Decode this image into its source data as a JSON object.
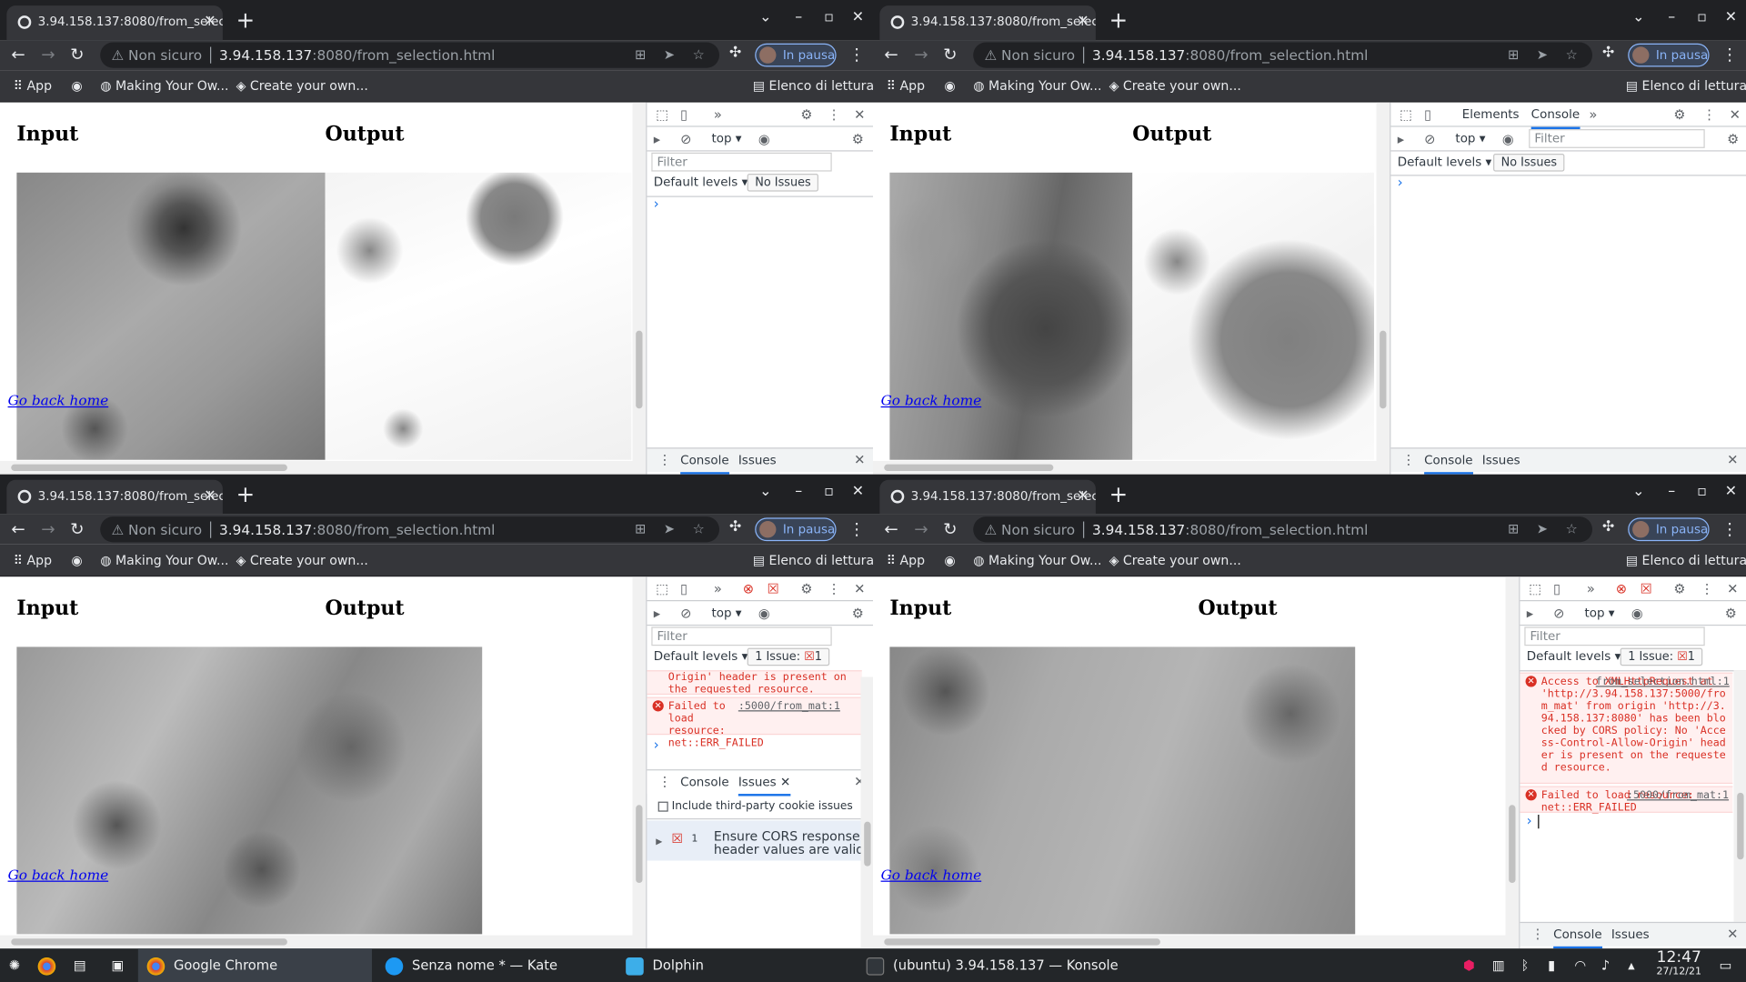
{
  "browser": {
    "tab_title": "3.94.158.137:8080/from_selec",
    "new_tab": "+",
    "tab_close": "✕",
    "url_security": "Non sicuro",
    "url_host": "3.94.158.137",
    "url_rest": ":8080/from_selection.html",
    "profile_status": "In pausa",
    "bookmarks": [
      "App",
      "Making Your Ow...",
      "Create your own...",
      "Elenco di lettura"
    ]
  },
  "page": {
    "input_heading": "Input",
    "output_heading": "Output",
    "go_back_link": "Go back home"
  },
  "devtools": {
    "context": "top",
    "filter_placeholder": "Filter",
    "default_levels": "Default levels",
    "no_issues": "No Issues",
    "one_issue": "1 Issue:",
    "issue_count": "1",
    "tab_elements": "Elements",
    "tab_console": "Console",
    "tab_issues": "Issues",
    "prompt": "›",
    "cors_tail": "Origin' header is present on the requested resource.",
    "failed_prefix": "Failed to load resource: net::ERR_FAILED",
    "failed_source": ":5000/from_mat:1",
    "access_prefix": "Access to XMLHttpRequest at 'http://3.94.158.137:5000/from_mat' from origin 'http://3.94.158.137:8080' has been blocked by CORS policy: No 'Access-Control-Allow-Origin' header is present on the requested resource.",
    "access_source": "from_selection.html:1",
    "include_third_party": "Include third-party cookie issues",
    "issue_title": "Ensure CORS response header values are valid",
    "issue_sidebar_count": "1"
  },
  "taskbar": {
    "items": [
      "Google Chrome",
      "Senza nome * — Kate",
      "Dolphin",
      "(ubuntu) 3.94.158.137 — Konsole"
    ],
    "time": "12:47",
    "date": "27/12/21"
  },
  "colors": {
    "chrome_dark": "#202124",
    "chrome_toolbar": "#35363a",
    "link": "#0000ee",
    "error": "#d93025",
    "accent": "#1a73e8"
  }
}
